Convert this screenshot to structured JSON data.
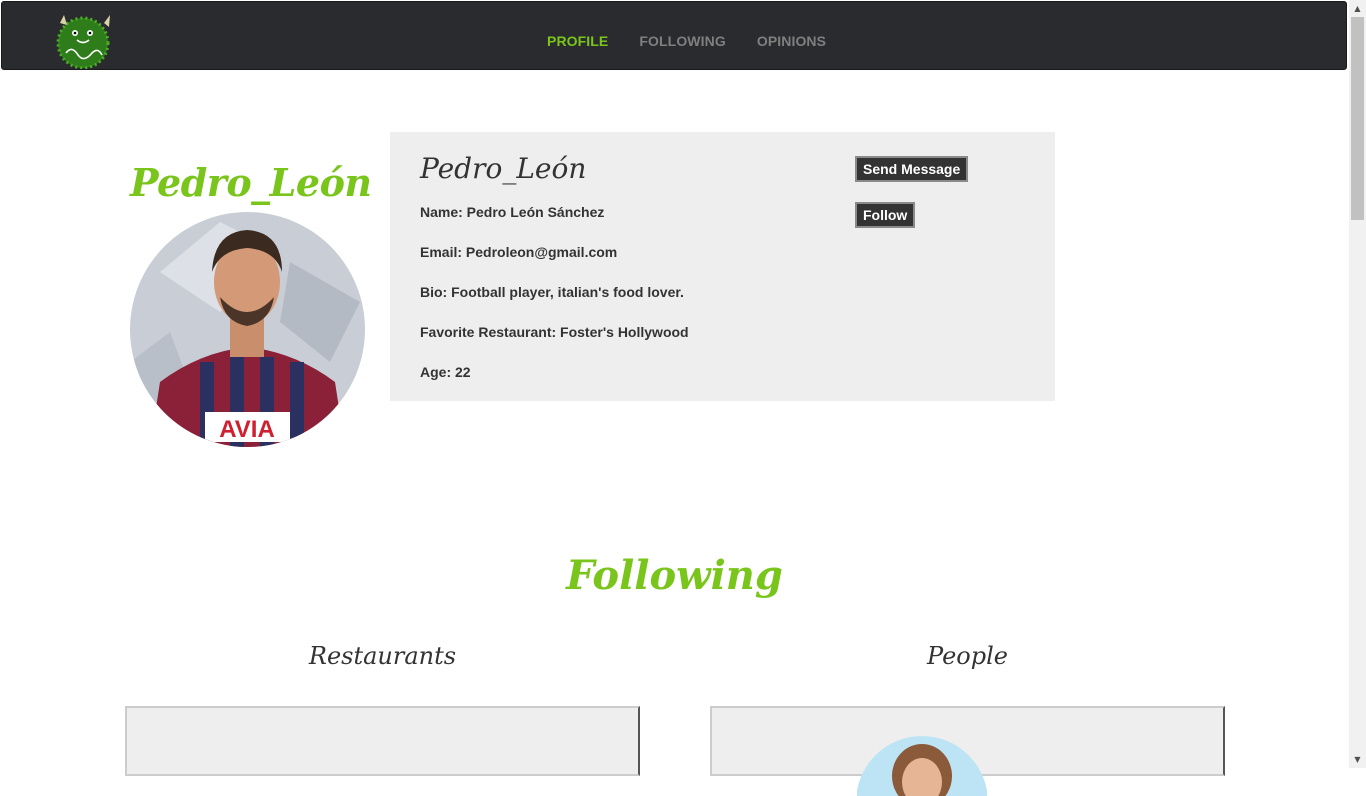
{
  "nav": {
    "items": [
      {
        "label": "PROFILE",
        "active": true
      },
      {
        "label": "FOLLOWING",
        "active": false
      },
      {
        "label": "OPINIONS",
        "active": false
      }
    ],
    "accent_color": "#7ac51b"
  },
  "profile": {
    "username_heading": "Pedro_León",
    "username": "Pedro_León",
    "name_line": "Name: Pedro León Sánchez",
    "email_line": "Email: Pedroleon@gmail.com",
    "bio_line": "Bio: Football player, italian's food lover.",
    "restaurant_line": "Favorite Restaurant: Foster's Hollywood",
    "age_line": "Age: 22",
    "avatar_icon": "player-photo",
    "send_message_label": "Send Message",
    "follow_label": "Follow"
  },
  "following": {
    "title": "Following",
    "restaurants_title": "Restaurants",
    "people_title": "People"
  }
}
